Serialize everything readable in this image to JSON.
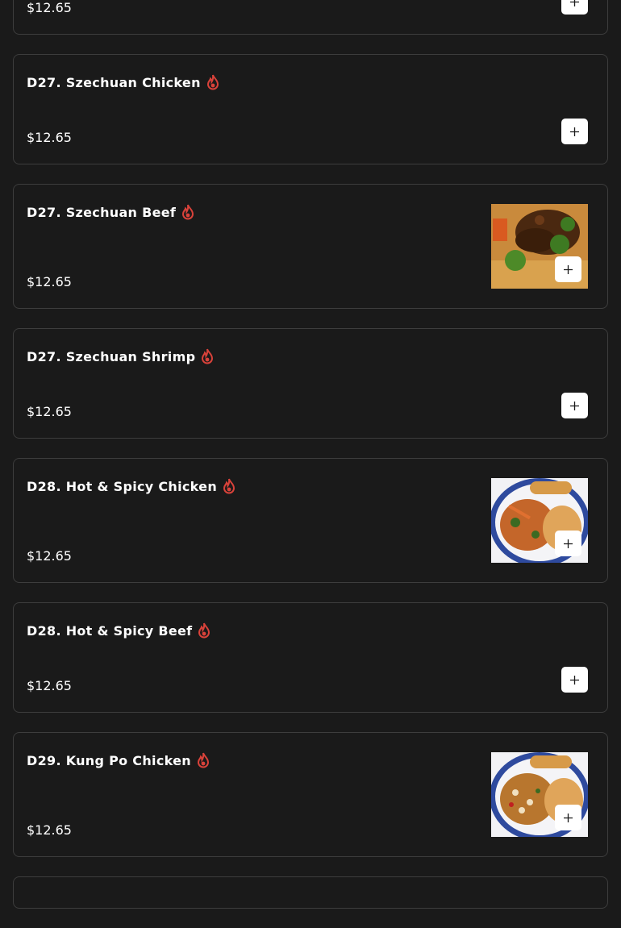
{
  "currency_symbol": "$",
  "items": [
    {
      "name": "",
      "price": "$12.65",
      "spicy": false,
      "has_image": false
    },
    {
      "name": "D27. Szechuan Chicken",
      "price": "$12.65",
      "spicy": true,
      "has_image": false
    },
    {
      "name": "D27. Szechuan Beef",
      "price": "$12.65",
      "spicy": true,
      "has_image": true,
      "image": "beef-broccoli-photo"
    },
    {
      "name": "D27. Szechuan Shrimp",
      "price": "$12.65",
      "spicy": true,
      "has_image": false
    },
    {
      "name": "D28. Hot & Spicy Chicken",
      "price": "$12.65",
      "spicy": true,
      "has_image": true,
      "image": "chicken-plate-photo"
    },
    {
      "name": "D28. Hot & Spicy Beef",
      "price": "$12.65",
      "spicy": true,
      "has_image": false
    },
    {
      "name": "D29. Kung Po Chicken",
      "price": "$12.65",
      "spicy": true,
      "has_image": true,
      "image": "kung-po-plate-photo"
    }
  ],
  "icons": {
    "spicy": "flame-icon",
    "add": "plus-icon"
  },
  "colors": {
    "background": "#1a1a1a",
    "card_border": "#3d3d3d",
    "spicy": "#d9423a",
    "button_bg": "#ffffff",
    "text": "#ffffff"
  }
}
